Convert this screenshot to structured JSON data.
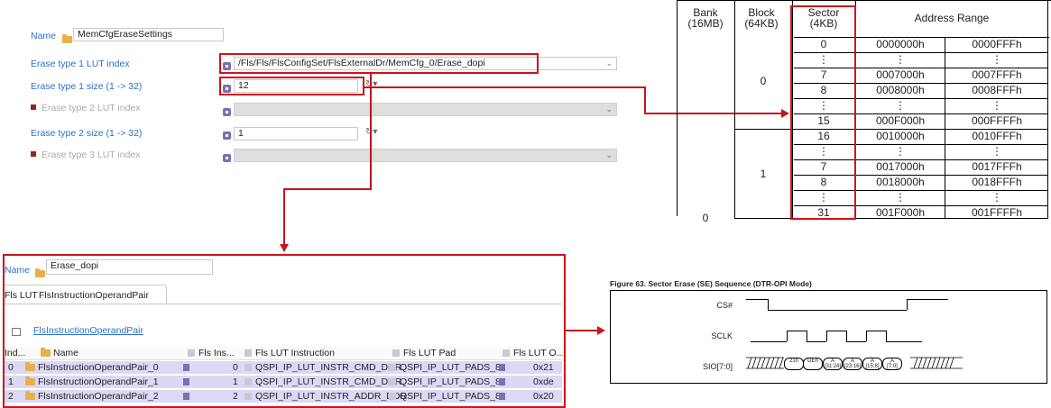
{
  "top_panel": {
    "name_label": "Name",
    "name_value": "MemCfgEraseSettings",
    "rows": [
      {
        "label": "Erase type 1 LUT index",
        "value": "/Fls/Fls/FlsConfigSet/FlsExternalDr/MemCfg_0/Erase_dopi"
      },
      {
        "label": "Erase type 1 size (1 -> 32)",
        "value": "12"
      },
      {
        "label": "Erase type 2 LUT index",
        "value": ""
      },
      {
        "label": "Erase type 2 size (1 -> 32)",
        "value": "1"
      },
      {
        "label": "Erase type 3 LUT index",
        "value": ""
      }
    ]
  },
  "address_table": {
    "headers": {
      "bank": "Bank\n(16MB)",
      "block": "Block\n(64KB)",
      "sector": "Sector\n(4KB)",
      "range": "Address Range"
    },
    "block_0_label": "0",
    "block_1_label": "1",
    "bank_label": "0",
    "rows": [
      {
        "sector": "0",
        "start": "0000000h",
        "end": "0000FFFh"
      },
      {
        "sector": "⋮",
        "start": "⋮",
        "end": "⋮"
      },
      {
        "sector": "7",
        "start": "0007000h",
        "end": "0007FFFh"
      },
      {
        "sector": "8",
        "start": "0008000h",
        "end": "0008FFFh"
      },
      {
        "sector": "⋮",
        "start": "⋮",
        "end": "⋮"
      },
      {
        "sector": "15",
        "start": "000F000h",
        "end": "000FFFFh"
      },
      {
        "sector": "16",
        "start": "0010000h",
        "end": "0010FFFh"
      },
      {
        "sector": "⋮",
        "start": "⋮",
        "end": "⋮"
      },
      {
        "sector": "7",
        "start": "0017000h",
        "end": "0017FFFh"
      },
      {
        "sector": "8",
        "start": "0018000h",
        "end": "0018FFFh"
      },
      {
        "sector": "⋮",
        "start": "⋮",
        "end": "⋮"
      },
      {
        "sector": "31",
        "start": "001F000h",
        "end": "001FFFFh"
      }
    ]
  },
  "bottom_panel": {
    "name_label": "Name",
    "name_value": "Erase_dopi",
    "tabs": [
      "Fls LUT",
      "FlsInstructionOperandPair"
    ],
    "section_title": "FlsInstructionOperandPair",
    "columns": [
      "Ind...",
      "Name",
      "Fls Ins...",
      "Fls LUT Instruction",
      "Fls LUT Pad",
      "Fls LUT O..."
    ],
    "rows": [
      {
        "index": "0",
        "name": "FlsInstructionOperandPair_0",
        "ins": "0",
        "instr": "QSPI_IP_LUT_INSTR_CMD_DDR",
        "pad": "QSPI_IP_LUT_PADS_8",
        "operand": "0x21"
      },
      {
        "index": "1",
        "name": "FlsInstructionOperandPair_1",
        "ins": "1",
        "instr": "QSPI_IP_LUT_INSTR_CMD_DDR",
        "pad": "QSPI_IP_LUT_PADS_8",
        "operand": "0xde"
      },
      {
        "index": "2",
        "name": "FlsInstructionOperandPair_2",
        "ins": "2",
        "instr": "QSPI_IP_LUT_INSTR_ADDR_DDR",
        "pad": "QSPI_IP_LUT_PADS_8",
        "operand": "0x20"
      }
    ]
  },
  "figure": {
    "title": "Figure 63. Sector Erase (SE) Sequence (DTR-OPI Mode)",
    "signals": [
      "CS#",
      "SCLK",
      "SIO[7:0]"
    ],
    "sio_boxes": [
      "21h",
      "DEh",
      "A\n[31:24]",
      "A\n[23:16]",
      "A\n[15:8]",
      "A\n[7:0]"
    ]
  },
  "colors": {
    "accent": "#2a6fc9",
    "highlight": "#d0121b",
    "selected_row": "#dcd9f6"
  }
}
